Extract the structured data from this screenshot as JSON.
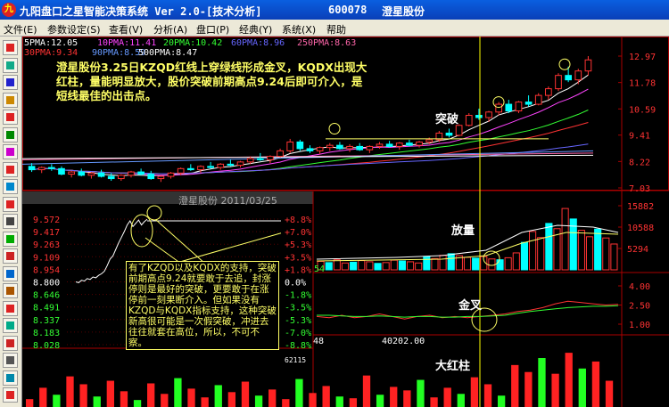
{
  "title_bar": {
    "app_icon": "九",
    "title": "九阳盘口之星智能决策系统 Ver 2.0-[技术分析]",
    "stock_code": "600078",
    "stock_name": "澄星股份"
  },
  "menu": [
    "文件(E)",
    "参数设定(S)",
    "查看(V)",
    "分析(A)",
    "盘口(P)",
    "经典(Y)",
    "系统(X)",
    "帮助"
  ],
  "toolbar_icons": [
    "chart-icon",
    "candle-icon",
    "bar-icon",
    "line-icon",
    "kline-icon",
    "volume-icon",
    "index-icon",
    "wave-icon",
    "tool-icon",
    "flag-icon",
    "grid-icon",
    "info-icon",
    "pie-icon",
    "trend-icon",
    "gear-icon",
    "filter-icon",
    "star-icon",
    "doc-icon",
    "person-icon",
    "list-icon",
    "red-flag-icon"
  ],
  "colors": {
    "up": "#ff3333",
    "down": "#00ffff",
    "yellow": "#ffff66",
    "grid": "#aa0000",
    "vline": "#ffff00"
  },
  "ma_row1": [
    {
      "text": "5PMA:12.05",
      "color": "#ffffff"
    },
    {
      "text": "10PMA:11.41",
      "color": "#ff44ff"
    },
    {
      "text": "20PMA:10.42",
      "color": "#33ff33"
    },
    {
      "text": "60PMA:8.96",
      "color": "#6666ff"
    },
    {
      "text": "250PMA:8.63",
      "color": "#ff66aa"
    }
  ],
  "ma_row2": [
    {
      "text": "30PMA:9.34",
      "color": "#ff3333"
    },
    {
      "text": "90PMA:8.59",
      "color": "#6699ff"
    },
    {
      "text": "500PMA:8.47",
      "color": "#ffffff"
    }
  ],
  "price_axis": [
    "12.97",
    "11.78",
    "10.59",
    "9.41",
    "8.22",
    "7.03"
  ],
  "annotation_main": "澄星股份3.25日KZQD红线上穿绿线形成金叉，KQDX出现大红柱，量能明显放大，股价突破前期高点9.24后即可介入，是短线最佳的出击点。",
  "label_breakout": "突破",
  "label_volume_up": "放量",
  "label_golden_cross": "金叉",
  "label_big_red": "大红柱",
  "intraday_title": "澄星股份  2011/03/25",
  "intraday_left_axis": [
    "9.572",
    "9.417",
    "9.263",
    "9.109",
    "8.954",
    "8.800",
    "8.646",
    "8.491",
    "8.337",
    "8.183",
    "8.028"
  ],
  "intraday_right_axis": [
    "+8.8%",
    "+7.0%",
    "+5.3%",
    "+3.5%",
    "+1.8%",
    "0.0%",
    "-1.8%",
    "-3.5%",
    "-5.3%",
    "-7.0%",
    "-8.8%"
  ],
  "annotation_intraday": "有了KZQD以及KQDX的支持，突破前期高点9.24就要敢于去追，封涨停则是最好的突破，更要敢于在涨停前一刻果断介入。但如果没有KZQD与KQDX指标支持，这种突破新高很可能是一次假突破，冲进去往往就套在高位，所以，不可不察。",
  "volume_axis": [
    "15882",
    "10588",
    "5294"
  ],
  "volume_value": "54",
  "kzqd_axis": [
    "4.00",
    "2.50",
    "1.00"
  ],
  "kqdx_values": {
    "left": "48",
    "mid": "40202.00",
    "low": "62115"
  },
  "chart_data": [
    {
      "type": "candlestick",
      "title": "",
      "ylim": [
        7.03,
        12.97
      ],
      "ohlc": [
        [
          8.0,
          8.15,
          7.75,
          7.85
        ],
        [
          7.85,
          8.0,
          7.7,
          7.95
        ],
        [
          7.95,
          8.1,
          7.8,
          7.9
        ],
        [
          7.9,
          8.0,
          7.6,
          7.65
        ],
        [
          7.65,
          7.8,
          7.5,
          7.75
        ],
        [
          7.75,
          7.9,
          7.55,
          7.6
        ],
        [
          7.6,
          7.75,
          7.45,
          7.7
        ],
        [
          7.7,
          7.85,
          7.5,
          7.55
        ],
        [
          7.55,
          7.7,
          7.35,
          7.45
        ],
        [
          7.45,
          7.65,
          7.35,
          7.6
        ],
        [
          7.6,
          7.8,
          7.5,
          7.75
        ],
        [
          7.75,
          7.9,
          7.6,
          7.65
        ],
        [
          7.65,
          7.8,
          7.4,
          7.45
        ],
        [
          7.45,
          7.6,
          7.3,
          7.55
        ],
        [
          7.55,
          7.75,
          7.45,
          7.7
        ],
        [
          7.7,
          7.95,
          7.6,
          7.9
        ],
        [
          7.9,
          8.1,
          7.8,
          7.85
        ],
        [
          7.85,
          8.05,
          7.7,
          8.0
        ],
        [
          8.0,
          8.2,
          7.9,
          7.95
        ],
        [
          7.95,
          8.15,
          7.85,
          8.1
        ],
        [
          8.1,
          8.3,
          8.0,
          8.05
        ],
        [
          8.05,
          8.25,
          7.95,
          8.2
        ],
        [
          8.2,
          8.45,
          8.1,
          8.35
        ],
        [
          8.35,
          8.6,
          8.25,
          8.3
        ],
        [
          8.3,
          8.5,
          8.15,
          8.45
        ],
        [
          8.45,
          8.8,
          8.4,
          8.7
        ],
        [
          8.7,
          9.24,
          8.6,
          9.1
        ],
        [
          9.1,
          9.2,
          8.7,
          8.8
        ],
        [
          8.8,
          8.95,
          8.6,
          8.7
        ],
        [
          8.7,
          8.9,
          8.55,
          8.85
        ],
        [
          8.85,
          9.05,
          8.7,
          8.95
        ],
        [
          8.95,
          9.1,
          8.75,
          8.8
        ],
        [
          8.8,
          9.0,
          8.65,
          8.9
        ],
        [
          8.9,
          9.05,
          8.7,
          8.75
        ],
        [
          8.75,
          8.95,
          8.6,
          8.9
        ],
        [
          8.9,
          9.1,
          8.8,
          9.0
        ],
        [
          9.0,
          9.15,
          8.85,
          8.9
        ],
        [
          8.9,
          9.1,
          8.75,
          9.05
        ],
        [
          9.05,
          9.2,
          8.9,
          8.95
        ],
        [
          8.95,
          9.15,
          8.85,
          9.1
        ],
        [
          9.1,
          9.3,
          9.0,
          9.2
        ],
        [
          9.2,
          9.6,
          9.1,
          9.5
        ],
        [
          9.5,
          9.7,
          9.3,
          9.4
        ],
        [
          9.4,
          9.9,
          9.35,
          9.85
        ],
        [
          9.85,
          10.4,
          9.8,
          10.3
        ],
        [
          10.3,
          10.6,
          10.1,
          10.2
        ],
        [
          10.2,
          10.5,
          10.0,
          10.45
        ],
        [
          10.45,
          10.9,
          10.3,
          10.8
        ],
        [
          10.8,
          11.0,
          10.4,
          10.5
        ],
        [
          10.5,
          10.95,
          10.4,
          10.9
        ],
        [
          10.9,
          11.2,
          10.7,
          10.8
        ],
        [
          10.8,
          11.3,
          10.75,
          11.2
        ],
        [
          11.2,
          11.6,
          11.0,
          11.5
        ],
        [
          11.5,
          12.2,
          11.4,
          12.1
        ],
        [
          12.1,
          12.5,
          11.8,
          11.9
        ],
        [
          11.9,
          12.4,
          11.7,
          12.3
        ],
        [
          12.3,
          12.97,
          12.1,
          12.8
        ]
      ]
    },
    {
      "type": "line",
      "title": "澄星股份  2011/03/25",
      "ylim": [
        8.028,
        9.572
      ],
      "y": [
        8.8,
        8.79,
        8.82,
        8.81,
        8.84,
        8.83,
        8.86,
        8.85,
        8.88,
        8.9,
        8.93,
        9.0,
        9.08,
        9.12,
        9.2,
        9.28,
        9.35,
        9.42,
        9.5,
        9.55,
        9.48,
        9.52,
        9.56,
        9.5,
        9.54,
        9.57
      ]
    },
    {
      "type": "bar",
      "title": "",
      "ylim": [
        0,
        15882
      ],
      "values": [
        2100,
        1800,
        2500,
        1700,
        1900,
        2300,
        2000,
        1600,
        1800,
        2400,
        2200,
        2000,
        1700,
        3200,
        2800,
        3600,
        4000,
        3500,
        3100,
        2900,
        3300,
        2700,
        2500,
        3000,
        4200,
        6800,
        9500,
        8000,
        11500,
        10200,
        15200,
        12600,
        9800,
        8200,
        10100,
        7900,
        6400
      ]
    },
    {
      "type": "line",
      "title": "",
      "ylim": [
        1.0,
        4.0
      ],
      "series": [
        {
          "values": [
            1.6,
            1.5,
            1.7,
            1.5,
            1.6,
            1.8,
            1.6,
            1.4,
            1.6,
            1.7,
            1.5,
            1.6,
            1.5,
            1.6,
            1.7,
            1.8,
            2.0,
            2.1,
            2.3,
            2.6,
            2.8,
            2.7,
            2.6,
            2.5,
            2.55
          ]
        },
        {
          "values": [
            1.7,
            1.7,
            1.65,
            1.6,
            1.6,
            1.65,
            1.6,
            1.55,
            1.6,
            1.6,
            1.55,
            1.55,
            1.6,
            1.6,
            1.65,
            1.7,
            1.85,
            2.0,
            2.1,
            2.2,
            2.3,
            2.35,
            2.4,
            2.4,
            2.45
          ]
        }
      ]
    },
    {
      "type": "bar",
      "title": "",
      "ylim": [
        0,
        62115
      ],
      "values": [
        9000,
        22000,
        14000,
        35000,
        26000,
        12000,
        30000,
        18000,
        8000,
        27000,
        15000,
        33000,
        21000,
        11000,
        25000,
        17000,
        29000,
        13000,
        20000,
        9000,
        32000,
        16000,
        24000,
        12000,
        10000,
        36000,
        14000,
        23000,
        19000,
        31000,
        11000,
        22000,
        15000,
        34000,
        26000,
        13000,
        48000,
        40000,
        56000,
        38000,
        62000,
        44000,
        52000,
        30000
      ]
    }
  ]
}
